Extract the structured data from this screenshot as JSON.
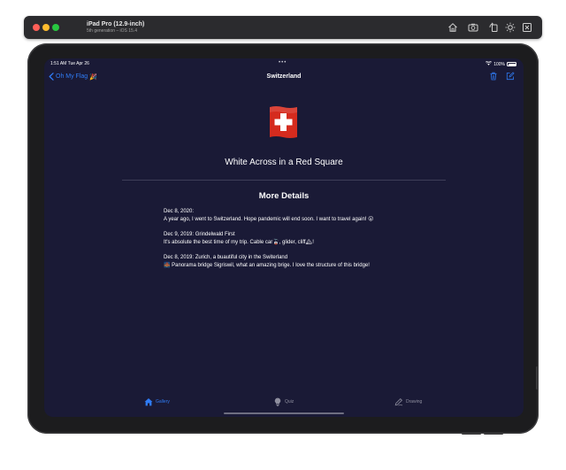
{
  "simulator": {
    "title": "iPad Pro (12.9-inch)",
    "subtitle": "5th generation – iOS 15.4",
    "toolbar_icons": [
      "home-icon",
      "screenshot-icon",
      "rotate-icon",
      "brightness-icon",
      "close-window-icon"
    ]
  },
  "status_bar": {
    "time_date": "1:51 AM   Tue Apr 26",
    "dots": "•••",
    "battery": "100%"
  },
  "nav": {
    "back_label": "Oh My Flag",
    "back_emoji": "🎉",
    "title": "Switzerland"
  },
  "flag": {
    "colors": {
      "field": "#d52b1e",
      "cross": "#ffffff"
    },
    "title": "White Across in a Red Square"
  },
  "details": {
    "heading": "More Details",
    "entries": [
      {
        "line1": "Dec 8, 2020:",
        "line2": "A year ago, I went to Switzerland. Hope pandemic will end soon. I want to travel again! 😮"
      },
      {
        "line1": "Dec 9, 2019: Grindelwald First",
        "line2": "It's absolute the best time of my trip. Cable car🚡, glider, cliff🏔!"
      },
      {
        "line1": "Dec 8, 2019: Zurich, a buautiful city in the Switerland",
        "line2": "🌉 Panorama bridge Sigriswil, what an amazing brige. I love the structure of this bridge!"
      }
    ]
  },
  "tabs": [
    {
      "label": "Gallery",
      "icon": "house-icon",
      "selected": true
    },
    {
      "label": "Quiz",
      "icon": "lightbulb-icon",
      "selected": false
    },
    {
      "label": "Drawing",
      "icon": "pencil-icon",
      "selected": false
    }
  ],
  "colors": {
    "accent": "#2f7cf6",
    "background": "#1a1a36",
    "text": "#ffffff",
    "inactive": "#8e8e9e"
  }
}
